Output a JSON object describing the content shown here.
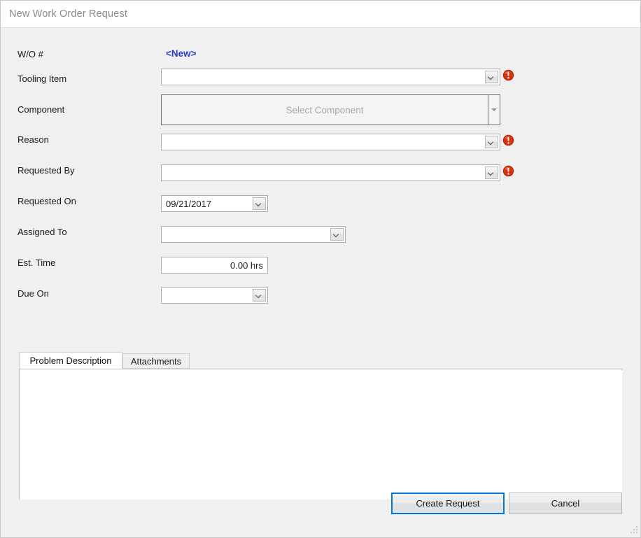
{
  "window": {
    "title": "New Work Order Request"
  },
  "form": {
    "rows": [
      {
        "label": "W/O #",
        "kind": "static",
        "value": "<New>"
      },
      {
        "label": "Tooling Item",
        "kind": "combo",
        "value": "",
        "error": true
      },
      {
        "label": "Component",
        "kind": "component",
        "placeholder": "Select Component"
      },
      {
        "label": "Reason",
        "kind": "combo",
        "value": "",
        "error": true
      },
      {
        "label": "Requested By",
        "kind": "combo",
        "value": "",
        "error": true
      },
      {
        "label": "Requested On",
        "kind": "date",
        "value": "09/21/2017"
      },
      {
        "label": "Assigned To",
        "kind": "combo",
        "value": ""
      },
      {
        "label": "Est. Time",
        "kind": "text",
        "value": "0.00 hrs"
      },
      {
        "label": "Due On",
        "kind": "date",
        "value": ""
      }
    ]
  },
  "tabs": {
    "items": [
      {
        "label": "Problem Description",
        "active": true
      },
      {
        "label": "Attachments",
        "active": false
      }
    ],
    "description_value": "",
    "description_placeholder": ""
  },
  "actions": {
    "create_label": "Create Request",
    "cancel_label": "Cancel"
  },
  "colors": {
    "accent": "#0078d7",
    "link": "#2a3fc4",
    "error": "#e03b12",
    "window_bg": "#f0f0f0",
    "title_text": "#898989"
  }
}
